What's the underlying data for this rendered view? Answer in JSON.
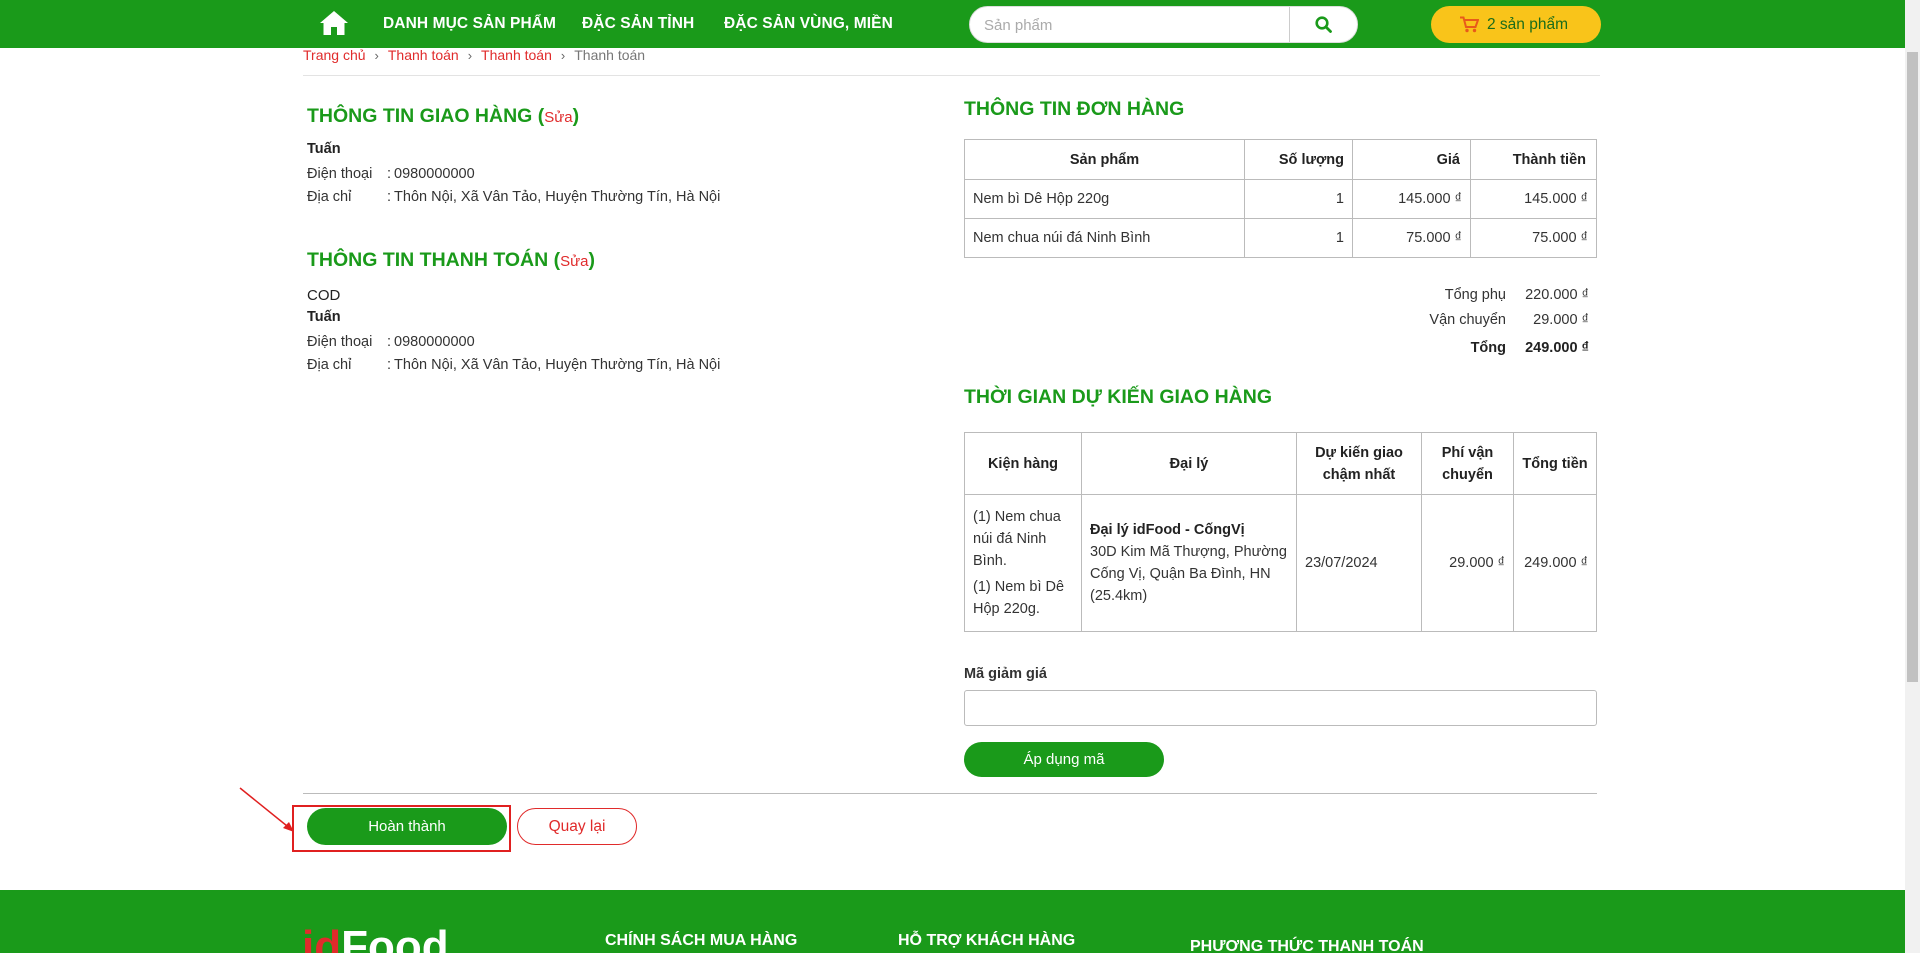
{
  "header": {
    "nav": [
      "DANH MỤC SẢN PHẨM",
      "ĐẶC SẢN TỈNH",
      "ĐẶC SẢN VÙNG, MIỀN"
    ],
    "search_placeholder": "Sản phẩm",
    "cart_label": "2 sản phẩm"
  },
  "breadcrumb": [
    "Trang chủ",
    "Thanh toán",
    "Thanh toán",
    "Thanh toán"
  ],
  "shipping": {
    "title": "THÔNG TIN GIAO HÀNG",
    "edit": "Sửa",
    "name": "Tuấn",
    "phone_label": "Điện thoại",
    "phone": "0980000000",
    "address_label": "Địa chỉ",
    "address": "Thôn Nội, Xã Vân Tảo, Huyện Thường Tín, Hà Nội"
  },
  "payment": {
    "title": "THÔNG TIN THANH TOÁN",
    "edit": "Sửa",
    "method": "COD",
    "name": "Tuấn",
    "phone_label": "Điện thoại",
    "phone": "0980000000",
    "address_label": "Địa chỉ",
    "address": "Thôn Nội, Xã Vân Tảo, Huyện Thường Tín, Hà Nội"
  },
  "order": {
    "title": "THÔNG TIN ĐƠN HÀNG",
    "headers": [
      "Sản phẩm",
      "Số lượng",
      "Giá",
      "Thành tiền"
    ],
    "rows": [
      {
        "product": "Nem bì Dê Hộp 220g",
        "qty": "1",
        "price": "145.000 ₫",
        "total": "145.000 ₫"
      },
      {
        "product": "Nem chua núi đá Ninh Bình",
        "qty": "1",
        "price": "75.000 ₫",
        "total": "75.000 ₫"
      }
    ],
    "subtotal_label": "Tổng phụ",
    "subtotal": "220.000 ₫",
    "shipping_label": "Vận chuyển",
    "shipping": "29.000 ₫",
    "total_label": "Tổng",
    "total": "249.000 ₫"
  },
  "delivery": {
    "title": "THỜI GIAN DỰ KIẾN GIAO HÀNG",
    "headers": [
      "Kiện hàng",
      "Đại lý",
      "Dự kiến giao chậm nhất",
      "Phí vận chuyển",
      "Tổng tiền"
    ],
    "package_items": [
      "(1) Nem chua núi đá Ninh Bình.",
      "(1) Nem bì Dê Hộp 220g."
    ],
    "agent_name": "Đại lý idFood - CốngVị",
    "agent_address": "30D Kim Mã Thượng, Phường Cống Vị, Quận Ba Đình, HN (25.4km)",
    "eta": "23/07/2024",
    "fee": "29.000 ₫",
    "total": "249.000 ₫"
  },
  "coupon": {
    "label": "Mã giảm giá",
    "value": "",
    "apply": "Áp dụng mã"
  },
  "actions": {
    "finish": "Hoàn thành",
    "back": "Quay lại"
  },
  "footer": {
    "logo_id": "id",
    "logo_rest": "Food",
    "headings": [
      "CHÍNH SÁCH MUA HÀNG",
      "HỖ TRỢ KHÁCH HÀNG",
      "PHƯƠNG THỨC THANH TOÁN"
    ]
  },
  "colors": {
    "brand_green": "#1a9a1a",
    "accent_red": "#e02b2b",
    "cart_yellow": "#f9c41a"
  }
}
